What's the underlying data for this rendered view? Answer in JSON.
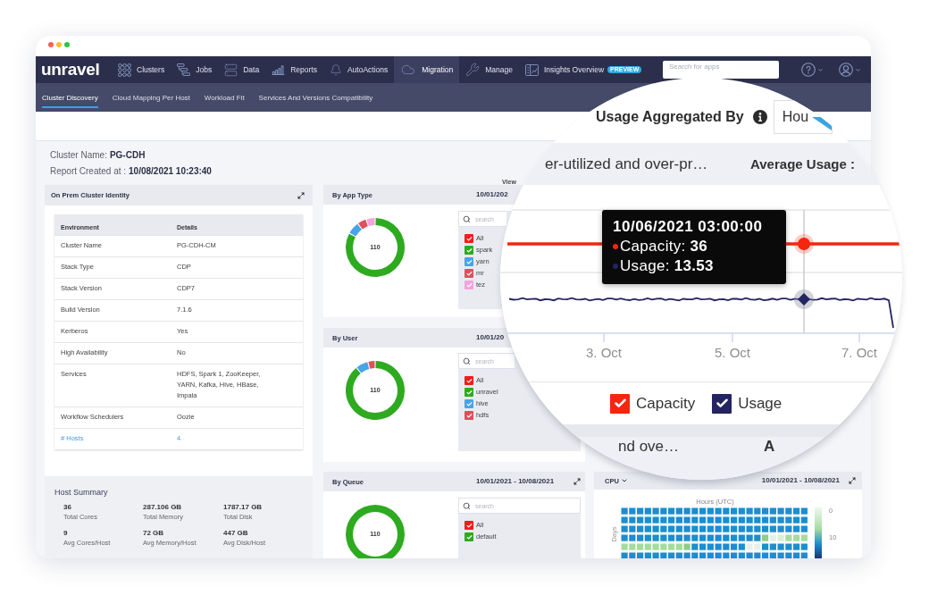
{
  "nav": {
    "logo": "unravel",
    "items": [
      {
        "label": "Clusters",
        "selected": false
      },
      {
        "label": "Jobs",
        "selected": false
      },
      {
        "label": "Data",
        "selected": false
      },
      {
        "label": "Reports",
        "selected": false
      },
      {
        "label": "AutoActions",
        "selected": false
      },
      {
        "label": "Migration",
        "selected": true
      },
      {
        "label": "Manage",
        "selected": false
      },
      {
        "label": "Insights Overview",
        "selected": false,
        "badge": "PREVIEW"
      }
    ],
    "search": {
      "placeholder": "Search for apps"
    }
  },
  "subnav": {
    "tabs": [
      {
        "label": "Cluster Discovery",
        "selected": true
      },
      {
        "label": "Cloud Mapping Per Host",
        "selected": false
      },
      {
        "label": "Workload Fit",
        "selected": false
      },
      {
        "label": "Services And Versions Compatibility",
        "selected": false
      }
    ]
  },
  "report": {
    "cluster_name_label": "Cluster Name:",
    "cluster_name": "PG-CDH",
    "created_label": "Report Created at :",
    "created_at": "10/08/2021 10:23:40",
    "view_label": "View"
  },
  "identity_panel": {
    "title": "On Prem Cluster Identity",
    "columns": [
      "Environment",
      "Details"
    ],
    "rows": [
      {
        "label": "Cluster Name",
        "value": "PG-CDH-CM",
        "kind": "text"
      },
      {
        "label": "Stack Type",
        "value": "CDP",
        "kind": "text"
      },
      {
        "label": "Stack Version",
        "value": "CDP7",
        "kind": "text"
      },
      {
        "label": "Build Version",
        "value": "7.1.6",
        "kind": "text"
      },
      {
        "label": "Kerberos",
        "value": "Yes",
        "kind": "text"
      },
      {
        "label": "High Availability",
        "value": "No",
        "kind": "text"
      },
      {
        "label": "Services",
        "value": "HDFS, Spark 1, ZooKeeper, YARN, Kafka, Hive, HBase, Impala",
        "kind": "text"
      },
      {
        "label": "Workflow Schedulers",
        "value": "Oozie",
        "kind": "text"
      },
      {
        "label": "# Hosts",
        "value": "4",
        "kind": "link"
      }
    ]
  },
  "host_summary": {
    "title": "Host Summary",
    "stats": [
      {
        "value": "36",
        "label": "Total Cores"
      },
      {
        "value": "287.106 GB",
        "label": "Total Memory"
      },
      {
        "value": "1787.17 GB",
        "label": "Total Disk"
      },
      {
        "value": "9",
        "label": "Avg Cores/Host"
      },
      {
        "value": "72 GB",
        "label": "Avg Memory/Host"
      },
      {
        "value": "447 GB",
        "label": "Avg Disk/Host"
      }
    ]
  },
  "breakdown_panels": [
    {
      "title": "By App Type",
      "date_range": "10/01/202",
      "expand_icon": false,
      "total": "110",
      "search": {
        "placeholder": "search"
      },
      "items": [
        {
          "label": "All",
          "checked": true,
          "color": "#f21c1c"
        },
        {
          "label": "spark",
          "checked": true,
          "color": "#2eaa20"
        },
        {
          "label": "yarn",
          "checked": true,
          "color": "#48a4e8"
        },
        {
          "label": "mr",
          "checked": true,
          "color": "#e0505a"
        },
        {
          "label": "tez",
          "checked": true,
          "color": "#f6a2dc"
        }
      ]
    },
    {
      "title": "By User",
      "date_range": "10/01/20",
      "expand_icon": false,
      "total": "110",
      "search": {
        "placeholder": "search"
      },
      "items": [
        {
          "label": "All",
          "checked": true,
          "color": "#f21c1c"
        },
        {
          "label": "unravel",
          "checked": true,
          "color": "#2eaa20"
        },
        {
          "label": "hive",
          "checked": true,
          "color": "#48a4e8"
        },
        {
          "label": "hdfs",
          "checked": true,
          "color": "#e0505a"
        }
      ]
    },
    {
      "title": "By Queue",
      "date_range": "10/01/2021 - 10/08/2021",
      "expand_icon": true,
      "total": "110",
      "search": {
        "placeholder": "search"
      },
      "items": [
        {
          "label": "All",
          "checked": true,
          "color": "#f21c1c"
        },
        {
          "label": "default",
          "checked": true,
          "color": "#2eaa20"
        }
      ]
    }
  ],
  "usage_lens": {
    "aggregation_label": "Usage Aggregated By",
    "aggregation": {
      "value": "Hou"
    },
    "subtitle": "er-utilized and over-pr…",
    "average_label": "Average Usage :",
    "tooltip": {
      "title": "10/06/2021 03:00:00",
      "rows": [
        {
          "label": "Capacity:",
          "value": "36",
          "color": "#f5260f"
        },
        {
          "label": "Usage:",
          "value": "13.53",
          "color": "#232461"
        }
      ]
    },
    "x_labels": [
      "3. Oct",
      "5. Oct",
      "7. Oct"
    ],
    "legend": [
      {
        "label": "Capacity",
        "checked": true,
        "color": "#f5260f"
      },
      {
        "label": "Usage",
        "checked": true,
        "color": "#232461"
      }
    ],
    "next_title": "nd ove…",
    "next_average": "A"
  },
  "cpu_panel": {
    "metric": "CPU",
    "date_range": "10/01/2021 - 10/08/2021",
    "x_title": "Hours (UTC)",
    "y_title": "Days",
    "scale_labels": [
      "0",
      "10"
    ]
  }
}
